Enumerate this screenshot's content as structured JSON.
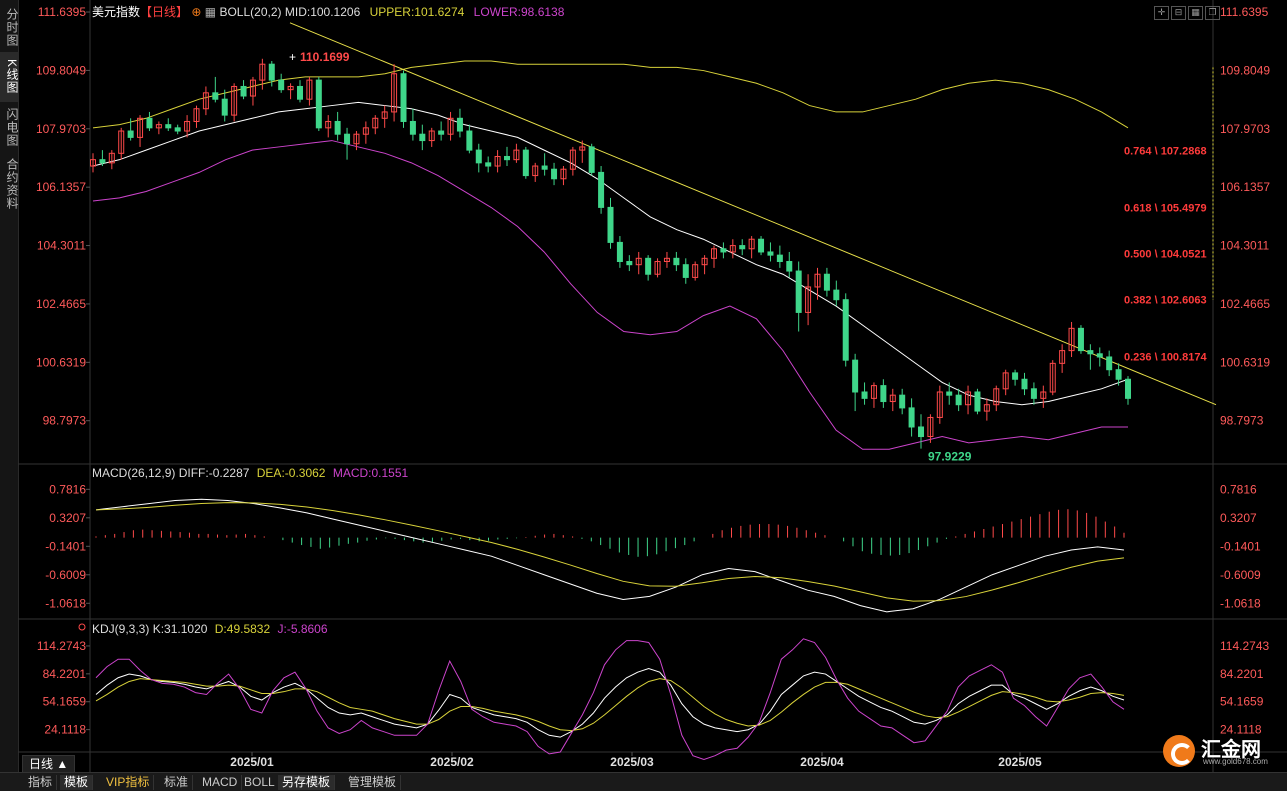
{
  "left_tabs": [
    "分时图",
    "K线图",
    "闪电图",
    "合约资料"
  ],
  "header": {
    "instrument": "美元指数",
    "period_tag": "【日线】",
    "boll_label": "BOLL(20,2)",
    "mid_label": "MID:100.1206",
    "upper_label": "UPPER:101.6274",
    "lower_label": "LOWER:98.6138"
  },
  "macd_header": {
    "title": "MACD(26,12,9)",
    "diff": "DIFF:-0.2287",
    "dea": "DEA:-0.3062",
    "macd": "MACD:0.1551"
  },
  "kdj_header": {
    "title": "KDJ(9,3,3)",
    "k": "K:31.1020",
    "d": "D:49.5832",
    "j": "J:-5.8606"
  },
  "price_ticks": [
    "111.6395",
    "109.8049",
    "107.9703",
    "106.1357",
    "104.3011",
    "102.4665",
    "100.6319",
    "98.7973"
  ],
  "macd_ticks": [
    "0.7816",
    "0.3207",
    "-0.1401",
    "-0.6009",
    "-1.0618"
  ],
  "kdj_ticks": [
    "114.2743",
    "84.2201",
    "54.1659",
    "24.1118"
  ],
  "date_labels": [
    "2025/01",
    "2025/02",
    "2025/03",
    "2025/04",
    "2025/05"
  ],
  "fib_labels": [
    "0.764 \\ 107.2868",
    "0.618 \\ 105.4979",
    "0.500 \\ 104.0521",
    "0.382 \\ 102.6063",
    "0.236 \\ 100.8174"
  ],
  "high_label": "110.1699",
  "low_label": "97.9229",
  "period_button": "日线 ▲",
  "bottom_tabs": [
    "指标",
    "模板",
    "VIP指标",
    "标准",
    "MACD",
    "BOLL",
    "另存模板",
    "管理模板"
  ],
  "logo": {
    "name": "汇金网",
    "url": "www.gold678.com"
  },
  "colors": {
    "up": "#ff4a4a",
    "down": "#3fd68a",
    "upper": "#d8d23a",
    "mid": "#ffffff",
    "lower": "#cc44cc",
    "trend": "#e8e04a",
    "fib": "#ff3b3b"
  },
  "chart_data": {
    "type": "candlestick",
    "title": "美元指数",
    "price_axis": {
      "min": 97.5,
      "max": 111.64
    },
    "candles": [
      [
        106.8,
        107.2,
        106.6,
        107.0
      ],
      [
        107.0,
        107.3,
        106.8,
        106.9
      ],
      [
        106.9,
        107.3,
        106.7,
        107.2
      ],
      [
        107.2,
        108.0,
        107.0,
        107.9
      ],
      [
        107.9,
        108.3,
        107.6,
        107.7
      ],
      [
        107.7,
        108.4,
        107.4,
        108.3
      ],
      [
        108.3,
        108.5,
        107.9,
        108.0
      ],
      [
        108.0,
        108.2,
        107.8,
        108.1
      ],
      [
        108.1,
        108.3,
        107.9,
        108.0
      ],
      [
        108.0,
        108.1,
        107.8,
        107.9
      ],
      [
        107.9,
        108.4,
        107.7,
        108.2
      ],
      [
        108.2,
        108.7,
        108.0,
        108.6
      ],
      [
        108.6,
        109.3,
        108.4,
        109.1
      ],
      [
        109.1,
        109.6,
        108.8,
        108.9
      ],
      [
        108.9,
        109.2,
        108.2,
        108.4
      ],
      [
        108.4,
        109.4,
        108.2,
        109.3
      ],
      [
        109.3,
        109.5,
        108.9,
        109.0
      ],
      [
        109.0,
        109.6,
        108.7,
        109.5
      ],
      [
        109.5,
        110.17,
        109.2,
        110.0
      ],
      [
        110.0,
        110.1,
        109.3,
        109.5
      ],
      [
        109.5,
        109.7,
        109.1,
        109.2
      ],
      [
        109.2,
        109.4,
        108.9,
        109.3
      ],
      [
        109.3,
        109.5,
        108.8,
        108.9
      ],
      [
        108.9,
        109.6,
        108.7,
        109.5
      ],
      [
        109.5,
        109.6,
        107.9,
        108.0
      ],
      [
        108.0,
        108.4,
        107.7,
        108.2
      ],
      [
        108.2,
        108.5,
        107.6,
        107.8
      ],
      [
        107.8,
        108.0,
        107.0,
        107.5
      ],
      [
        107.5,
        107.9,
        107.3,
        107.8
      ],
      [
        107.8,
        108.2,
        107.5,
        108.0
      ],
      [
        108.0,
        108.4,
        107.8,
        108.3
      ],
      [
        108.3,
        108.7,
        108.0,
        108.5
      ],
      [
        108.5,
        110.0,
        108.2,
        109.7
      ],
      [
        109.7,
        109.8,
        108.0,
        108.2
      ],
      [
        108.2,
        108.6,
        107.6,
        107.8
      ],
      [
        107.8,
        108.1,
        107.3,
        107.6
      ],
      [
        107.6,
        108.0,
        107.4,
        107.9
      ],
      [
        107.9,
        108.2,
        107.6,
        107.8
      ],
      [
        107.8,
        108.5,
        107.6,
        108.3
      ],
      [
        108.3,
        108.6,
        107.7,
        107.9
      ],
      [
        107.9,
        108.1,
        107.2,
        107.3
      ],
      [
        107.3,
        107.5,
        106.6,
        106.9
      ],
      [
        106.9,
        107.1,
        106.6,
        106.8
      ],
      [
        106.8,
        107.3,
        106.6,
        107.1
      ],
      [
        107.1,
        107.4,
        106.8,
        107.0
      ],
      [
        107.0,
        107.5,
        106.9,
        107.3
      ],
      [
        107.3,
        107.4,
        106.4,
        106.5
      ],
      [
        106.5,
        106.9,
        106.3,
        106.8
      ],
      [
        106.8,
        107.2,
        106.5,
        106.7
      ],
      [
        106.7,
        106.9,
        106.2,
        106.4
      ],
      [
        106.4,
        106.8,
        106.2,
        106.7
      ],
      [
        106.7,
        107.4,
        106.5,
        107.3
      ],
      [
        107.3,
        107.6,
        106.9,
        107.4
      ],
      [
        107.4,
        107.5,
        106.5,
        106.6
      ],
      [
        106.6,
        106.8,
        105.3,
        105.5
      ],
      [
        105.5,
        105.8,
        104.2,
        104.4
      ],
      [
        104.4,
        104.6,
        103.6,
        103.8
      ],
      [
        103.8,
        104.0,
        103.5,
        103.7
      ],
      [
        103.7,
        104.1,
        103.4,
        103.9
      ],
      [
        103.9,
        104.0,
        103.2,
        103.4
      ],
      [
        103.4,
        103.9,
        103.3,
        103.8
      ],
      [
        103.8,
        104.1,
        103.6,
        103.9
      ],
      [
        103.9,
        104.1,
        103.5,
        103.7
      ],
      [
        103.7,
        103.9,
        103.1,
        103.3
      ],
      [
        103.3,
        103.8,
        103.2,
        103.7
      ],
      [
        103.7,
        104.0,
        103.4,
        103.9
      ],
      [
        103.9,
        104.3,
        103.6,
        104.2
      ],
      [
        104.2,
        104.4,
        103.9,
        104.1
      ],
      [
        104.1,
        104.5,
        103.9,
        104.3
      ],
      [
        104.3,
        104.5,
        104.0,
        104.2
      ],
      [
        104.2,
        104.6,
        103.9,
        104.5
      ],
      [
        104.5,
        104.6,
        104.0,
        104.1
      ],
      [
        104.1,
        104.4,
        103.8,
        104.0
      ],
      [
        104.0,
        104.3,
        103.6,
        103.8
      ],
      [
        103.8,
        104.1,
        103.3,
        103.5
      ],
      [
        103.5,
        103.8,
        101.6,
        102.2
      ],
      [
        102.2,
        103.4,
        101.8,
        103.0
      ],
      [
        103.0,
        103.6,
        102.6,
        103.4
      ],
      [
        103.4,
        103.6,
        102.7,
        102.9
      ],
      [
        102.9,
        103.2,
        102.4,
        102.6
      ],
      [
        102.6,
        102.8,
        100.5,
        100.7
      ],
      [
        100.7,
        100.9,
        99.1,
        99.7
      ],
      [
        99.7,
        100.0,
        99.3,
        99.5
      ],
      [
        99.5,
        100.0,
        99.2,
        99.9
      ],
      [
        99.9,
        100.1,
        99.2,
        99.4
      ],
      [
        99.4,
        99.8,
        99.1,
        99.6
      ],
      [
        99.6,
        99.8,
        99.0,
        99.2
      ],
      [
        99.2,
        99.5,
        98.3,
        98.6
      ],
      [
        98.6,
        99.0,
        97.92,
        98.3
      ],
      [
        98.3,
        99.0,
        98.1,
        98.9
      ],
      [
        98.9,
        99.9,
        98.7,
        99.7
      ],
      [
        99.7,
        100.0,
        99.3,
        99.6
      ],
      [
        99.6,
        99.8,
        99.1,
        99.3
      ],
      [
        99.3,
        99.9,
        99.0,
        99.7
      ],
      [
        99.7,
        99.8,
        99.0,
        99.1
      ],
      [
        99.1,
        99.5,
        98.8,
        99.3
      ],
      [
        99.3,
        99.9,
        99.1,
        99.8
      ],
      [
        99.8,
        100.4,
        99.6,
        100.3
      ],
      [
        100.3,
        100.4,
        99.9,
        100.1
      ],
      [
        100.1,
        100.3,
        99.6,
        99.8
      ],
      [
        99.8,
        100.0,
        99.3,
        99.5
      ],
      [
        99.5,
        99.9,
        99.2,
        99.7
      ],
      [
        99.7,
        100.7,
        99.6,
        100.6
      ],
      [
        100.6,
        101.2,
        100.3,
        101.0
      ],
      [
        101.0,
        101.9,
        100.8,
        101.7
      ],
      [
        101.7,
        101.8,
        100.9,
        101.0
      ],
      [
        101.0,
        101.2,
        100.4,
        100.9
      ],
      [
        100.9,
        101.1,
        100.5,
        100.8
      ],
      [
        100.8,
        101.0,
        100.2,
        100.4
      ],
      [
        100.4,
        100.6,
        99.9,
        100.1
      ],
      [
        100.1,
        100.2,
        99.3,
        99.5
      ]
    ],
    "boll_upper": [
      108.0,
      108.1,
      108.3,
      108.6,
      108.9,
      109.1,
      109.3,
      109.5,
      109.6,
      109.6,
      109.6,
      109.7,
      109.9,
      110.0,
      110.1,
      110.1,
      110.0,
      110.0,
      110.0,
      110.0,
      110.0,
      109.9,
      109.9,
      109.8,
      109.6,
      109.4,
      109.1,
      108.7,
      108.5,
      108.5,
      108.7,
      108.9,
      109.2,
      109.4,
      109.5,
      109.4,
      109.2,
      108.9,
      108.5,
      108.0
    ],
    "boll_mid": [
      106.8,
      107.0,
      107.3,
      107.6,
      107.9,
      108.1,
      108.3,
      108.5,
      108.6,
      108.7,
      108.8,
      108.7,
      108.6,
      108.4,
      108.1,
      107.9,
      107.7,
      107.3,
      106.9,
      106.4,
      105.8,
      105.2,
      104.8,
      104.5,
      104.1,
      103.7,
      103.4,
      102.9,
      102.4,
      101.8,
      101.2,
      100.6,
      100.0,
      99.6,
      99.4,
      99.3,
      99.4,
      99.6,
      99.8,
      100.1
    ],
    "boll_lower": [
      105.7,
      105.8,
      106.0,
      106.3,
      106.6,
      107.0,
      107.3,
      107.4,
      107.5,
      107.6,
      107.4,
      107.2,
      106.9,
      106.5,
      106.0,
      105.5,
      104.9,
      104.1,
      103.1,
      102.2,
      101.6,
      101.5,
      101.6,
      102.1,
      102.4,
      102.0,
      101.0,
      99.7,
      98.5,
      97.9,
      97.9,
      98.1,
      98.3,
      98.1,
      98.2,
      98.3,
      98.2,
      98.4,
      98.6,
      98.6
    ],
    "macd_axis": {
      "min": -1.3,
      "max": 0.9
    },
    "macd_hist": [
      0.02,
      0.04,
      0.06,
      0.09,
      0.12,
      0.13,
      0.12,
      0.11,
      0.1,
      0.09,
      0.08,
      0.06,
      0.06,
      0.05,
      0.04,
      0.05,
      0.06,
      0.04,
      0.02,
      0.0,
      -0.04,
      -0.08,
      -0.12,
      -0.15,
      -0.18,
      -0.16,
      -0.13,
      -0.1,
      -0.08,
      -0.05,
      -0.03,
      -0.01,
      -0.02,
      -0.04,
      -0.06,
      -0.08,
      -0.07,
      -0.05,
      -0.03,
      -0.02,
      -0.04,
      -0.06,
      -0.05,
      -0.03,
      -0.02,
      -0.01,
      0.01,
      0.03,
      0.05,
      0.06,
      0.04,
      0.02,
      -0.02,
      -0.06,
      -0.12,
      -0.18,
      -0.24,
      -0.28,
      -0.31,
      -0.3,
      -0.27,
      -0.22,
      -0.17,
      -0.12,
      -0.06,
      0.0,
      0.06,
      0.12,
      0.16,
      0.19,
      0.21,
      0.22,
      0.22,
      0.21,
      0.19,
      0.16,
      0.12,
      0.08,
      0.04,
      0.0,
      -0.06,
      -0.14,
      -0.22,
      -0.26,
      -0.28,
      -0.29,
      -0.28,
      -0.25,
      -0.2,
      -0.14,
      -0.08,
      -0.02,
      0.02,
      0.06,
      0.1,
      0.14,
      0.18,
      0.22,
      0.26,
      0.3,
      0.34,
      0.38,
      0.42,
      0.45,
      0.46,
      0.44,
      0.4,
      0.34,
      0.26,
      0.18,
      0.08
    ],
    "kdj_axis": {
      "min": 0,
      "max": 125
    },
    "kdj_k": [
      62,
      72,
      80,
      84,
      82,
      78,
      76,
      75,
      73,
      70,
      68,
      72,
      76,
      70,
      60,
      56,
      64,
      70,
      74,
      68,
      58,
      48,
      42,
      40,
      42,
      38,
      34,
      30,
      28,
      26,
      30,
      45,
      62,
      58,
      48,
      44,
      40,
      38,
      36,
      32,
      24,
      18,
      16,
      22,
      30,
      42,
      58,
      70,
      80,
      86,
      90,
      86,
      72,
      52,
      38,
      30,
      26,
      24,
      22,
      24,
      30,
      44,
      62,
      72,
      82,
      86,
      84,
      76,
      68,
      60,
      54,
      48,
      44,
      38,
      32,
      30,
      34,
      40,
      52,
      60,
      66,
      72,
      72,
      62,
      58,
      52,
      46,
      52,
      60,
      66,
      70,
      66,
      60,
      56
    ],
    "kdj_d": [
      55,
      62,
      70,
      76,
      79,
      78,
      77,
      76,
      75,
      73,
      71,
      71,
      72,
      71,
      67,
      63,
      63,
      65,
      68,
      68,
      65,
      59,
      53,
      48,
      46,
      44,
      40,
      36,
      33,
      30,
      30,
      35,
      44,
      49,
      49,
      47,
      44,
      42,
      40,
      37,
      33,
      28,
      24,
      23,
      25,
      31,
      40,
      50,
      60,
      69,
      76,
      79,
      77,
      69,
      59,
      49,
      41,
      35,
      31,
      28,
      29,
      34,
      43,
      53,
      62,
      70,
      75,
      75,
      73,
      68,
      63,
      58,
      53,
      48,
      43,
      39,
      37,
      38,
      43,
      49,
      55,
      61,
      65,
      64,
      62,
      59,
      55,
      54,
      56,
      59,
      63,
      64,
      63,
      61
    ],
    "kdj_j": [
      80,
      92,
      100,
      100,
      88,
      78,
      74,
      73,
      70,
      64,
      62,
      74,
      84,
      68,
      46,
      42,
      66,
      80,
      86,
      68,
      44,
      26,
      20,
      24,
      34,
      26,
      22,
      18,
      18,
      18,
      30,
      66,
      98,
      76,
      46,
      38,
      32,
      30,
      28,
      22,
      6,
      -2,
      0,
      20,
      40,
      64,
      94,
      110,
      120,
      120,
      118,
      100,
      62,
      18,
      -4,
      -8,
      -4,
      2,
      4,
      16,
      32,
      64,
      100,
      110,
      122,
      118,
      102,
      78,
      58,
      44,
      36,
      28,
      26,
      18,
      10,
      12,
      28,
      44,
      70,
      82,
      88,
      94,
      86,
      58,
      50,
      38,
      28,
      48,
      68,
      80,
      84,
      70,
      54,
      46
    ]
  }
}
